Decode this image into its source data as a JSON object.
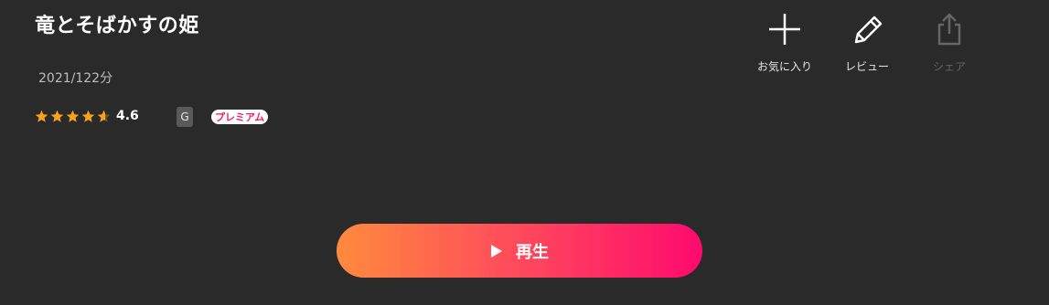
{
  "title": "竜とそばかすの姫",
  "meta": "2021/122分",
  "rating": {
    "value": 4.6,
    "display": "4.6",
    "stars_max": 5
  },
  "age_rating": "G",
  "premium_label": "プレミアム",
  "actions": {
    "favorite_label": "お気に入り",
    "review_label": "レビュー",
    "share_label": "シェア"
  },
  "play": {
    "label": "再生"
  },
  "colors": {
    "background": "#2a2a2a",
    "star": "#f7a21b",
    "play_gradient_start": "#ff8a3d",
    "play_gradient_end": "#ff0a6e",
    "premium_text": "#ee1f6a"
  },
  "icons": {
    "favorite": "plus-icon",
    "review": "pencil-icon",
    "share": "share-icon",
    "play": "play-icon",
    "rating": "star-icon"
  }
}
